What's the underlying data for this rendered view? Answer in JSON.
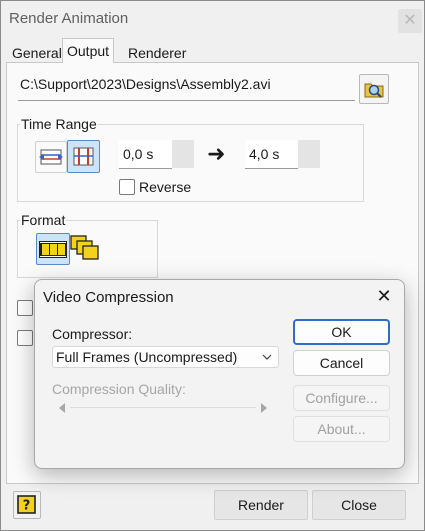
{
  "window": {
    "title": "Render Animation",
    "close_glyph": "✕"
  },
  "tabs": [
    {
      "label": "General"
    },
    {
      "label": "Output"
    },
    {
      "label": "Renderer"
    }
  ],
  "output": {
    "file_path": "C:\\Support\\2023\\Designs\\Assembly2.avi",
    "browse_icon": "folder-search-icon"
  },
  "time_range": {
    "group_label": "Time Range",
    "start_value": "0,0 s",
    "end_value": "4,0 s",
    "arrow_glyph": "➜",
    "reverse_label": "Reverse",
    "reverse_checked": false
  },
  "format": {
    "group_label": "Format"
  },
  "footer": {
    "render_label": "Render",
    "close_label": "Close"
  },
  "video_compression": {
    "title": "Video Compression",
    "close_glyph": "✕",
    "compressor_label": "Compressor:",
    "compressor_value": "Full Frames (Uncompressed)",
    "quality_label": "Compression Quality:",
    "ok_label": "OK",
    "cancel_label": "Cancel",
    "configure_label": "Configure...",
    "about_label": "About..."
  },
  "colors": {
    "accent": "#2f6ec8",
    "icon_yellow": "#f2d21a",
    "icon_red": "#d23a2a",
    "icon_blue": "#3a5fc8"
  }
}
